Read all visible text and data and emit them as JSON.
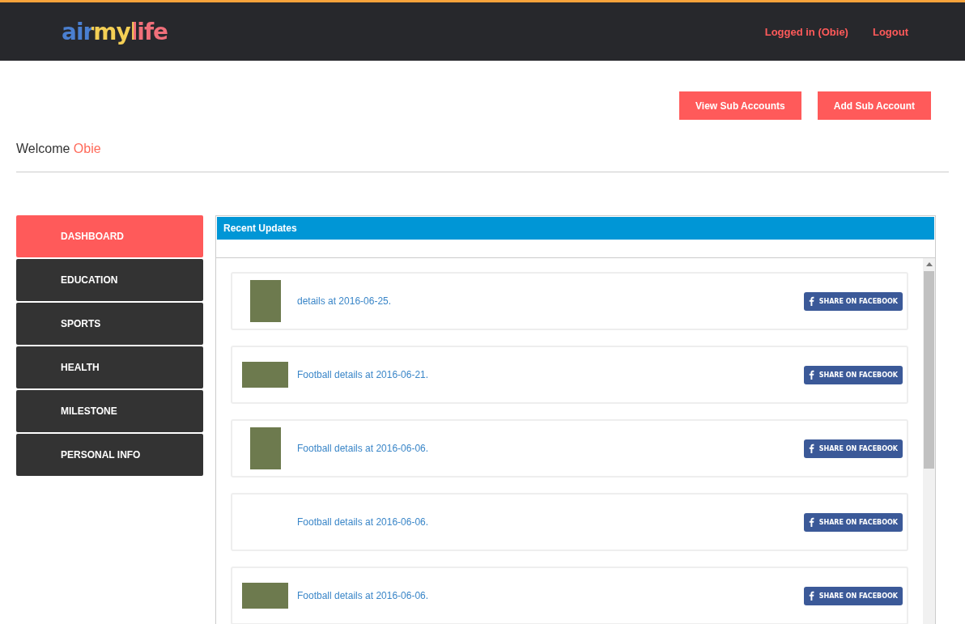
{
  "header": {
    "logo": "airmylife",
    "links": [
      "Logged in (Obie)",
      "Logout"
    ]
  },
  "actions": [
    "View Sub Accounts",
    "Add Sub Account"
  ],
  "welcome": {
    "greeting": "Welcome",
    "name": "Obie"
  },
  "sidebar": {
    "items": [
      {
        "label": "DASHBOARD",
        "selected": true
      },
      {
        "label": "EDUCATION",
        "selected": false
      },
      {
        "label": "SPORTS",
        "selected": false
      },
      {
        "label": "HEALTH",
        "selected": false
      },
      {
        "label": "MILESTONE",
        "selected": false
      },
      {
        "label": "PERSONAL INFO",
        "selected": false
      }
    ]
  },
  "updates": {
    "title": "Recent Updates",
    "items": [
      {
        "kind": "portrait",
        "text": "details at 2016-06-25.",
        "share": "SHARE ON FACEBOOK"
      },
      {
        "kind": "landscape",
        "text": "Football details at 2016-06-21.",
        "share": "SHARE ON FACEBOOK"
      },
      {
        "kind": "portrait",
        "text": "Football details at 2016-06-06.",
        "share": "SHARE ON FACEBOOK"
      },
      {
        "kind": "textonly",
        "text": "Football details at 2016-06-06.",
        "share": "SHARE ON FACEBOOK"
      },
      {
        "kind": "landscape",
        "text": "Football details at 2016-06-06.",
        "share": "SHARE ON FACEBOOK"
      }
    ]
  }
}
